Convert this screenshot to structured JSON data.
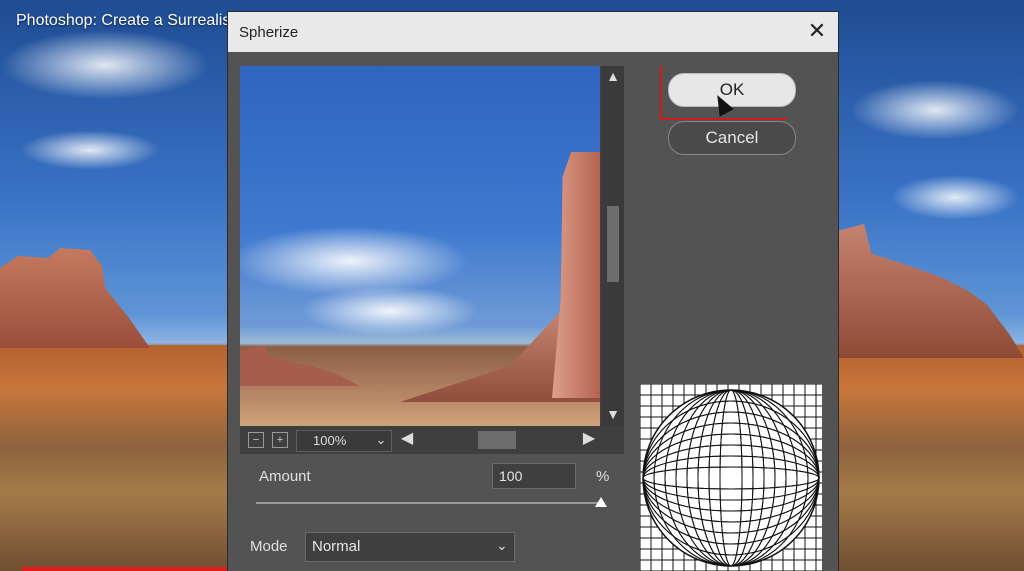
{
  "video": {
    "title": "Photoshop: Create a Surrealistic Glass Ball Landscape",
    "progress_percent": 22
  },
  "dialog": {
    "title": "Spherize",
    "close_icon": "close-icon",
    "buttons": {
      "ok": "OK",
      "cancel": "Cancel"
    },
    "preview": {
      "zoom": "100%",
      "zoom_out_icon": "zoom-out-icon",
      "zoom_in_icon": "zoom-in-icon"
    },
    "amount": {
      "label": "Amount",
      "value": "100",
      "unit": "%",
      "slider_fraction": 1.0
    },
    "mode": {
      "label": "Mode",
      "value": "Normal"
    }
  },
  "colors": {
    "dialog_bg": "#535353",
    "annotation_red": "#d01a1a",
    "progress_red": "#e21a1a"
  }
}
